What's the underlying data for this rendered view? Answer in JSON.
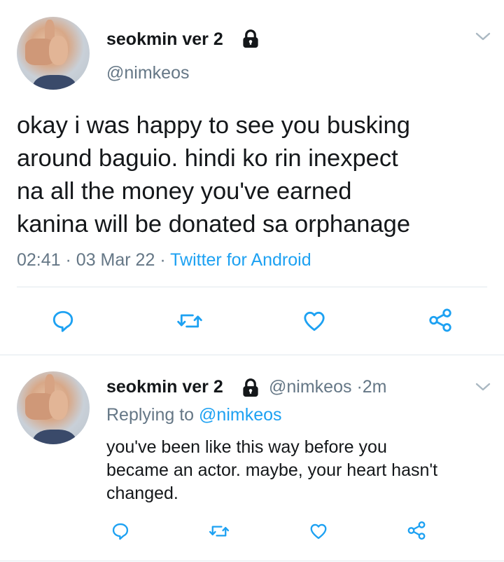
{
  "tweet": {
    "author_name": "seokmin ver 2",
    "author_handle": "@nimkeos",
    "lock_icon": "lock-icon",
    "text_lines": [
      "okay i was happy to see you busking",
      "around baguio. hindi ko rin inexpect",
      "na all the money you've earned",
      "kanina will be donated sa orphanage"
    ],
    "time": "02:41",
    "separator": "·",
    "date": "03 Mar 22",
    "source": "Twitter for Android",
    "actions": [
      "reply-icon",
      "retweet-icon",
      "like-icon",
      "share-icon"
    ]
  },
  "reply": {
    "author_name": "seokmin ver 2",
    "author_handle": "@nimkeos",
    "separator": "·",
    "age": "2m",
    "replying_to_label": "Replying to",
    "replying_to_handle": "@nimkeos",
    "text_lines": [
      "you've been like this way before you",
      "became an actor. maybe, your heart hasn't",
      "changed."
    ],
    "actions": [
      "reply-icon",
      "retweet-icon",
      "like-icon",
      "share-icon"
    ]
  },
  "colors": {
    "accent": "#1da1f2",
    "secondary_text": "#657786",
    "primary_text": "#14171a",
    "divider": "#e1e8ed"
  }
}
